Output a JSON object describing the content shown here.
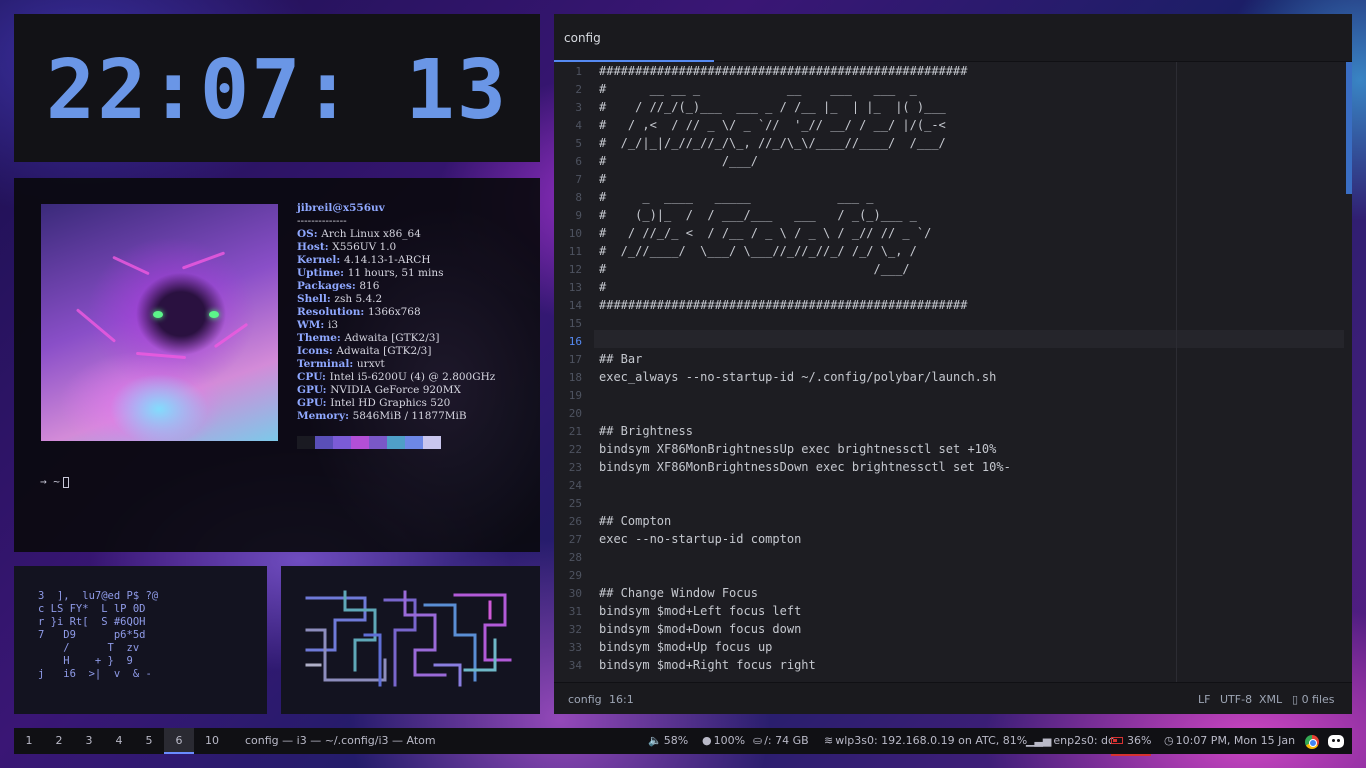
{
  "clock": {
    "time": "22:07: 13"
  },
  "terminal": {
    "user_host": "jibreil@x556uv",
    "separator": "--------------",
    "info": [
      {
        "key": "OS",
        "value": "Arch Linux x86_64"
      },
      {
        "key": "Host",
        "value": "X556UV 1.0"
      },
      {
        "key": "Kernel",
        "value": "4.14.13-1-ARCH"
      },
      {
        "key": "Uptime",
        "value": "11 hours, 51 mins"
      },
      {
        "key": "Packages",
        "value": "816"
      },
      {
        "key": "Shell",
        "value": "zsh 5.4.2"
      },
      {
        "key": "Resolution",
        "value": "1366x768"
      },
      {
        "key": "WM",
        "value": "i3"
      },
      {
        "key": "Theme",
        "value": "Adwaita [GTK2/3]"
      },
      {
        "key": "Icons",
        "value": "Adwaita [GTK2/3]"
      },
      {
        "key": "Terminal",
        "value": "urxvt"
      },
      {
        "key": "CPU",
        "value": "Intel i5-6200U (4) @ 2.800GHz"
      },
      {
        "key": "GPU",
        "value": "NVIDIA GeForce 920MX"
      },
      {
        "key": "GPU",
        "value": "Intel HD Graphics 520"
      },
      {
        "key": "Memory",
        "value": "5846MiB / 11877MiB"
      }
    ],
    "palette": [
      "#1a1a22",
      "#5a4fb8",
      "#7b5bd6",
      "#b24fd6",
      "#7a58c8",
      "#4f9fc8",
      "#6d88e6",
      "#c9c6ee"
    ],
    "prompt": "→ ~"
  },
  "matrix": {
    "rows": [
      "3  ],  lu7@ed P$ ?@",
      "c LS FY*  L lP 0D",
      "r }i Rt[  S #6QOH",
      "7   D9      p6*5d",
      "    /      T  zv",
      "    H    + }  9",
      "j   i6  >|  v  & -"
    ]
  },
  "editor": {
    "tab_title": "config",
    "current_line": 16,
    "lines": [
      "###################################################",
      "#      __ __ _            __    ___   ___  _",
      "#    / //_/(_)___  ___ _ / /__ |_  | |_  |( )___",
      "#   / ,<  / // _ \\/ _ `//  '_// __/ / __/ |/(_-<",
      "#  /_/|_|/_//_//_/\\_, //_/\\_\\/____//____/  /___/",
      "#                /___/",
      "#",
      "#     _  ____   _____            ___ _",
      "#    (_)|_  /  / ___/___   ___   / _(_)___ _",
      "#   / //_/_ <  / /__ / _ \\ / _ \\ / _// // _ `/",
      "#  /_//____/  \\___/ \\___//_//_//_/ /_/ \\_, /",
      "#                                     /___/",
      "#",
      "###################################################",
      "",
      "",
      "## Bar",
      "exec_always --no-startup-id ~/.config/polybar/launch.sh",
      "",
      "",
      "## Brightness",
      "bindsym XF86MonBrightnessUp exec brightnessctl set +10%",
      "bindsym XF86MonBrightnessDown exec brightnessctl set 10%-",
      "",
      "",
      "## Compton",
      "exec --no-startup-id compton",
      "",
      "",
      "## Change Window Focus",
      "bindsym $mod+Left focus left",
      "bindsym $mod+Down focus down",
      "bindsym $mod+Up focus up",
      "bindsym $mod+Right focus right"
    ],
    "status": {
      "file": "config",
      "cursor": "16:1",
      "line_ending": "LF",
      "encoding": "UTF-8",
      "grammar": "XML",
      "git": "0 files"
    }
  },
  "taskbar": {
    "workspaces": [
      "1",
      "2",
      "3",
      "4",
      "5",
      "6",
      "10"
    ],
    "active_workspace": "6",
    "window_title": "config — i3 — ~/.config/i3 — Atom",
    "volume": "58%",
    "brightness": "100%",
    "disk": "/: 74 GB",
    "wifi": "wlp3s0: 192.168.0.19 on ATC, 81%",
    "ethernet": "enp2s0: dc",
    "battery": "36%",
    "datetime": "10:07 PM, Mon 15 Jan",
    "colors": {
      "accent": "#6a8cff",
      "battery_low": "#d63232"
    }
  }
}
